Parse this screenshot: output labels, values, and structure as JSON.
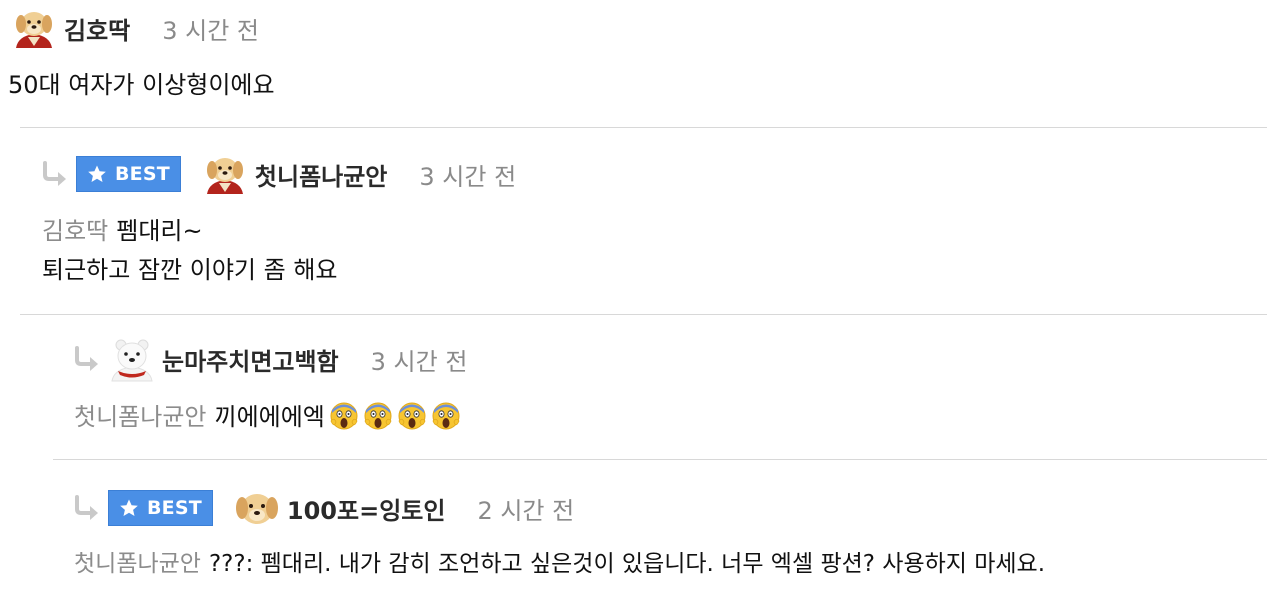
{
  "comments": [
    {
      "nickname": "김호딱",
      "time": "3 시간 전",
      "lines": [
        "50대 여자가 이상형이에요"
      ],
      "avatar": "puppy-avatar-icon"
    },
    {
      "badge": "BEST",
      "nickname": "첫니폼나균안",
      "time": "3 시간 전",
      "mention": "김호딱",
      "lines": [
        "펨대리~",
        "퇴근하고 잠깐 이야기 좀 해요"
      ],
      "avatar": "puppy-avatar-icon"
    },
    {
      "nickname": "눈마주치면고백함",
      "time": "3 시간 전",
      "mention": "첫니폼나균안",
      "lines": [
        "끼에에에엑"
      ],
      "emoji_count": 4,
      "emoji": "screaming-face-icon",
      "avatar": "polar-bear-avatar-icon"
    },
    {
      "badge": "BEST",
      "nickname": "100포=잉토인",
      "time": "2 시간 전",
      "mention": "첫니폼나균안",
      "lines": [
        "???: 펨대리. 내가 감히 조언하고 싶은것이 있읍니다. 너무 엑셀 팡션? 사용하지 마세요."
      ],
      "avatar": "puppy-face-avatar-icon"
    }
  ],
  "colors": {
    "best_badge": "#4a8fe6",
    "divider": "#d8d8d8",
    "muted_text": "#8a8a8a"
  }
}
